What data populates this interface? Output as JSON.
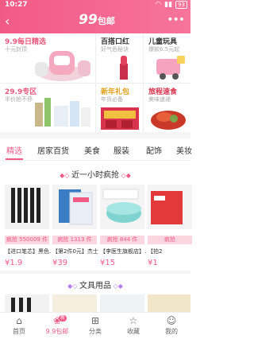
{
  "status": {
    "time": "10:27",
    "battery": "93"
  },
  "header": {
    "logo_num": "99",
    "logo_text": "包邮"
  },
  "promos": [
    {
      "title": "9.9每日精选",
      "sub": "十元封顶",
      "color": "#e85a7d"
    },
    {
      "title": "百搭口红",
      "sub": "好气色秘诀",
      "color": "#333333"
    },
    {
      "title": "儿童玩具",
      "sub": "爆款6.5元起",
      "color": "#333333"
    },
    {
      "title": "29.9专区",
      "sub": "半价抢不停",
      "color": "#e85a7d"
    },
    {
      "title": "新年礼包",
      "sub": "年货必备",
      "color": "#e0a01c"
    },
    {
      "title": "旅程速食",
      "sub": "美味速递",
      "color": "#d9344e"
    }
  ],
  "tabs": [
    "精选",
    "居家百货",
    "美食",
    "服装",
    "配饰",
    "美妆"
  ],
  "sections": {
    "flash": "近一小时疯抢",
    "stationery": "文具用品"
  },
  "products": [
    {
      "badge": "疯抢 550009 件",
      "name": "【进口笔芯】黑色…",
      "price": "¥1.9"
    },
    {
      "badge": "疯抢 1313 件",
      "name": "【第2件0元】杰士…",
      "price": "¥39"
    },
    {
      "badge": "疯抢 844 件",
      "name": "【李医生旗舰店】…",
      "price": "¥15"
    },
    {
      "badge": "疯抢",
      "name": "【拍2",
      "price": "¥1"
    }
  ],
  "nav": [
    {
      "label": "首页",
      "icon": "home-icon"
    },
    {
      "label": "9.9包邮",
      "icon": "bag-icon",
      "new": "新"
    },
    {
      "label": "分类",
      "icon": "category-icon"
    },
    {
      "label": "收藏",
      "icon": "star-icon"
    },
    {
      "label": "我的",
      "icon": "user-icon"
    }
  ]
}
